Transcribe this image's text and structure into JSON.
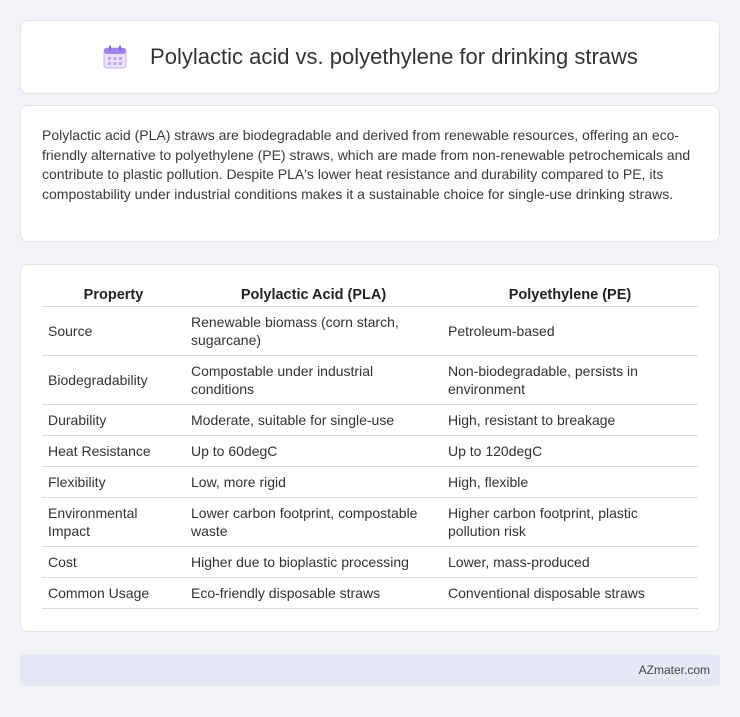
{
  "header": {
    "title": "Polylactic acid vs. polyethylene for drinking straws",
    "icon": "calendar-icon"
  },
  "summary": {
    "text": "Polylactic acid (PLA) straws are biodegradable and derived from renewable resources, offering an eco-friendly alternative to polyethylene (PE) straws, which are made from non-renewable petrochemicals and contribute to plastic pollution. Despite PLA's lower heat resistance and durability compared to PE, its compostability under industrial conditions makes it a sustainable choice for single-use drinking straws."
  },
  "table": {
    "headers": [
      "Property",
      "Polylactic Acid (PLA)",
      "Polyethylene (PE)"
    ],
    "rows": [
      [
        "Source",
        "Renewable biomass (corn starch, sugarcane)",
        "Petroleum-based"
      ],
      [
        "Biodegradability",
        "Compostable under industrial conditions",
        "Non-biodegradable, persists in environment"
      ],
      [
        "Durability",
        "Moderate, suitable for single-use",
        "High, resistant to breakage"
      ],
      [
        "Heat Resistance",
        "Up to 60degC",
        "Up to 120degC"
      ],
      [
        "Flexibility",
        "Low, more rigid",
        "High, flexible"
      ],
      [
        "Environmental Impact",
        "Lower carbon footprint, compostable waste",
        "Higher carbon footprint, plastic pollution risk"
      ],
      [
        "Cost",
        "Higher due to bioplastic processing",
        "Lower, mass-produced"
      ],
      [
        "Common Usage",
        "Eco-friendly disposable straws",
        "Conventional disposable straws"
      ]
    ]
  },
  "footer": {
    "text": "AZmater.com"
  }
}
